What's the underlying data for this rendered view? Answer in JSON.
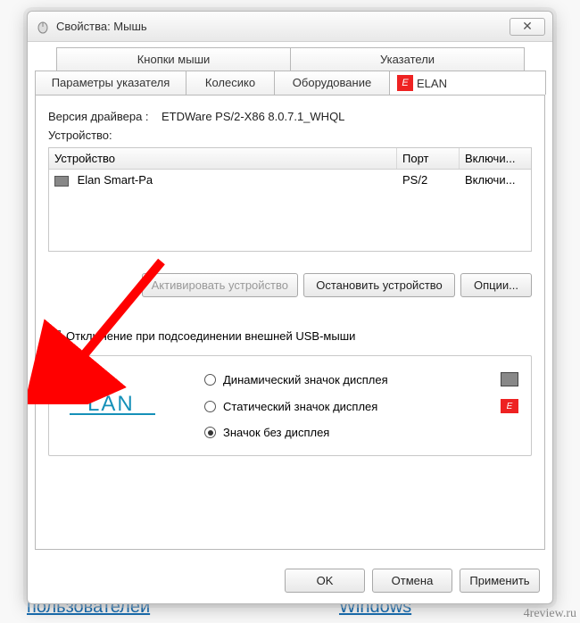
{
  "window": {
    "title": "Свойства: Мышь"
  },
  "tabs": {
    "row1": [
      "Кнопки мыши",
      "Указатели"
    ],
    "row2": [
      "Параметры указателя",
      "Колесико",
      "Оборудование",
      "ELAN"
    ]
  },
  "driver": {
    "label": "Версия драйвера :",
    "value": "ETDWare PS/2-X86 8.0.7.1_WHQL"
  },
  "device_label": "Устройство:",
  "table": {
    "headers": {
      "device": "Устройство",
      "port": "Порт",
      "enabled": "Включи..."
    },
    "row": {
      "device": "Elan Smart-Pa",
      "port": "PS/2",
      "enabled": "Включи..."
    }
  },
  "buttons": {
    "activate": "Активировать устройство",
    "stop": "Остановить устройство",
    "options": "Опции..."
  },
  "checkbox_label": "Отключение при подсоединении внешней USB-мыши",
  "radios": {
    "dynamic": "Динамический значок дисплея",
    "static": "Статический значок дисплея",
    "none": "Значок без дисплея"
  },
  "dialog_buttons": {
    "ok": "OK",
    "cancel": "Отмена",
    "apply": "Применить"
  },
  "watermark": "4review.ru",
  "bgtext": {
    "left": "пользователей",
    "right": "Windows"
  }
}
